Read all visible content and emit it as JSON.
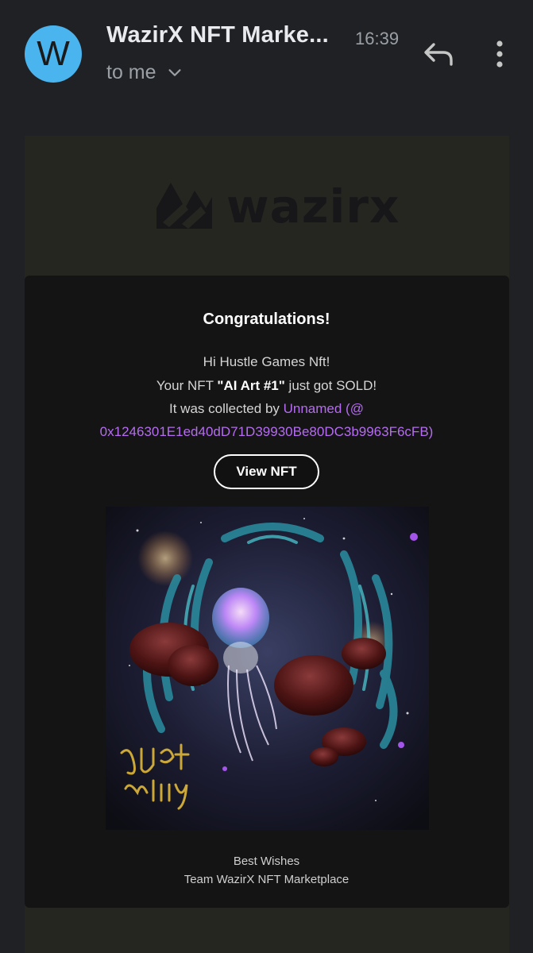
{
  "header": {
    "avatar_letter": "W",
    "sender": "WazirX NFT Marke...",
    "time": "16:39",
    "recipient": "to me",
    "icons": [
      "chevron-down-icon",
      "reply-icon",
      "more-vert-icon"
    ]
  },
  "email": {
    "logo_text": "wazirx",
    "title": "Congratulations!",
    "greeting": "Hi Hustle Games Nft!",
    "line2_prefix": "Your NFT ",
    "line2_nft": "\"AI Art #1\"",
    "line2_suffix": " just got SOLD!",
    "line3_prefix": "It was collected by ",
    "line3_collector": "Unnamed (@",
    "line4_address": "0x1246301E1ed40dD71D39930Be80DC3b9963F6cFB)",
    "view_button": "View NFT",
    "nft_image_text": "Just Milly",
    "signoff_1": "Best Wishes",
    "signoff_2": "Team WazirX NFT Marketplace"
  },
  "colors": {
    "background": "#202124",
    "avatar": "#4ab4ef",
    "card": "#141414",
    "accent_link": "#b56cf0"
  }
}
